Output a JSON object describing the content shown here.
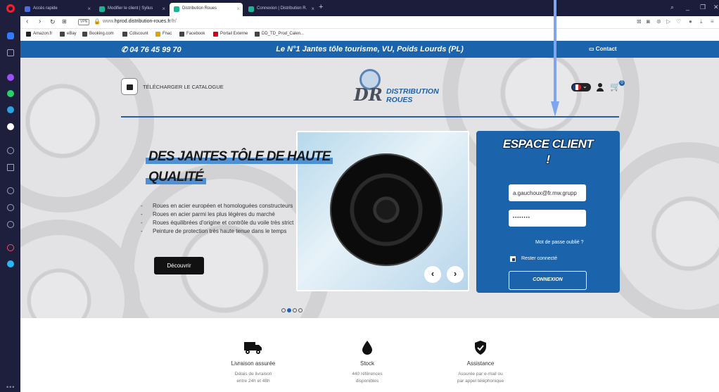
{
  "browser": {
    "tabs": [
      {
        "label": "Accès rapide",
        "fav": "#4a6ee0"
      },
      {
        "label": "Modifier le client | Sylius",
        "fav": "#1ab394"
      },
      {
        "label": "Distribution Roues",
        "fav": "#1ab394",
        "active": true
      },
      {
        "label": "Connexion | Distribution R.",
        "fav": "#1ab394"
      }
    ],
    "url_prefix": "www.",
    "url_host": "hprod.distribution-roues.fr",
    "url_path": "/fr/",
    "vpn": "VPN",
    "bookmarks": [
      {
        "label": "Amazon.fr",
        "fav": "#222"
      },
      {
        "label": "eBay",
        "fav": "#444"
      },
      {
        "label": "Booking.com",
        "fav": "#444"
      },
      {
        "label": "Cdiscount",
        "fav": "#444"
      },
      {
        "label": "Fnac",
        "fav": "#e1a200"
      },
      {
        "label": "Facebook",
        "fav": "#444"
      },
      {
        "label": "Portail Externe",
        "fav": "#d0021b"
      },
      {
        "label": "DD_TD_Prod_Calen...",
        "fav": "#444"
      }
    ]
  },
  "site": {
    "topbar": {
      "phone": "04 76 45 99 70",
      "tagline": "Le N°1 Jantes tôle tourisme, VU, Poids Lourds (PL)",
      "contact": "Contact"
    },
    "catalog_label": "TÉLÉCHARGER LE CATALOGUE",
    "logo": {
      "dr": "DR",
      "line1": "DISTRIBUTION",
      "line2": "ROUES"
    },
    "cart_count": "0",
    "hero": {
      "headline_1": "DES JANTES TÔLE DE HAUTE",
      "headline_2": "QUALITÉ",
      "bullets": [
        "Roues en acier européen et homologuées constructeurs",
        "Roues en acier parmi les plus légères du marché",
        "Roues équilibrées d'origine et contrôle du voile très strict",
        "Peinture de protection très haute tenue dans le temps"
      ],
      "cta": "Découvrir",
      "prev": "‹",
      "next": "›"
    },
    "login": {
      "title_1": "ESPACE CLIENT",
      "title_2": "!",
      "email_value": "a.gauchoux@fr.mw.grupp",
      "password_value": "••••••••",
      "forgot": "Mot de passe oublié ?",
      "remember": "Rester connecté",
      "submit": "CONNEXION"
    },
    "features": [
      {
        "name": "Livraison assurée",
        "desc_1": "Délais de livraison",
        "desc_2": "entre 24h et 48h"
      },
      {
        "name": "Stock",
        "desc_1": "440 références",
        "desc_2": "disponibles"
      },
      {
        "name": "Assistance",
        "desc_1": "Assurée par e-mail ou",
        "desc_2": "par appel téléphonique"
      }
    ]
  },
  "colors": {
    "brand_blue": "#1b64ab",
    "accent_blue": "#4f8fd4",
    "opera_red": "#ff1b2d"
  }
}
